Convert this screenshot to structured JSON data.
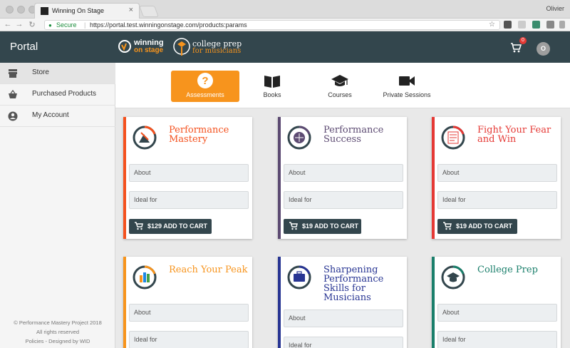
{
  "browser": {
    "tab_title": "Winning On Stage",
    "tab_close": "×",
    "user_name": "Olivier",
    "secure_label": "Secure",
    "url": "https://portal.test.winningonstage.com/products:params"
  },
  "header": {
    "title": "Portal",
    "logo1": {
      "line1": "winning",
      "line2": "on stage"
    },
    "logo2": {
      "line1": "college prep",
      "line2": "for musicians"
    },
    "cart_count": "0",
    "avatar_initial": "O"
  },
  "sidebar": {
    "items": [
      {
        "label": "Store",
        "icon": "store-icon",
        "active": true
      },
      {
        "label": "Purchased Products",
        "icon": "basket-icon",
        "active": false
      },
      {
        "label": "My Account",
        "icon": "account-icon",
        "active": false
      }
    ],
    "footer": {
      "line1": "© Performance Mastery Project 2018",
      "line2": "All rights reserved",
      "line3": "Policies - Designed by WID"
    }
  },
  "categories": [
    {
      "label": "Assessments",
      "icon": "question-icon",
      "active": true
    },
    {
      "label": "Books",
      "icon": "book-icon",
      "active": false
    },
    {
      "label": "Courses",
      "icon": "graduation-cap-icon",
      "active": false
    },
    {
      "label": "Private Sessions",
      "icon": "video-camera-icon",
      "active": false
    }
  ],
  "products": [
    {
      "title": "Performance Mastery",
      "color": "#f4511e",
      "about": "About",
      "ideal": "Ideal for",
      "button": "$129 ADD TO CART"
    },
    {
      "title": "Performance Success",
      "color": "#5c4a72",
      "about": "About",
      "ideal": "Ideal for",
      "button": "$19 ADD TO CART"
    },
    {
      "title": "Fight Your Fear and Win",
      "color": "#e53935",
      "about": "About",
      "ideal": "Ideal for",
      "button": "$19 ADD TO CART"
    },
    {
      "title": "Reach Your Peak",
      "color": "#f7941d",
      "about": "About",
      "ideal": "Ideal for",
      "button": ""
    },
    {
      "title": "Sharpening Performance Skills for Musicians",
      "color": "#283593",
      "about": "About",
      "ideal": "Ideal for",
      "button": ""
    },
    {
      "title": "College Prep",
      "color": "#1a7f6b",
      "about": "About",
      "ideal": "Ideal for",
      "button": ""
    }
  ],
  "colors": {
    "header_bg": "#33464d",
    "accent": "#f7941d"
  }
}
